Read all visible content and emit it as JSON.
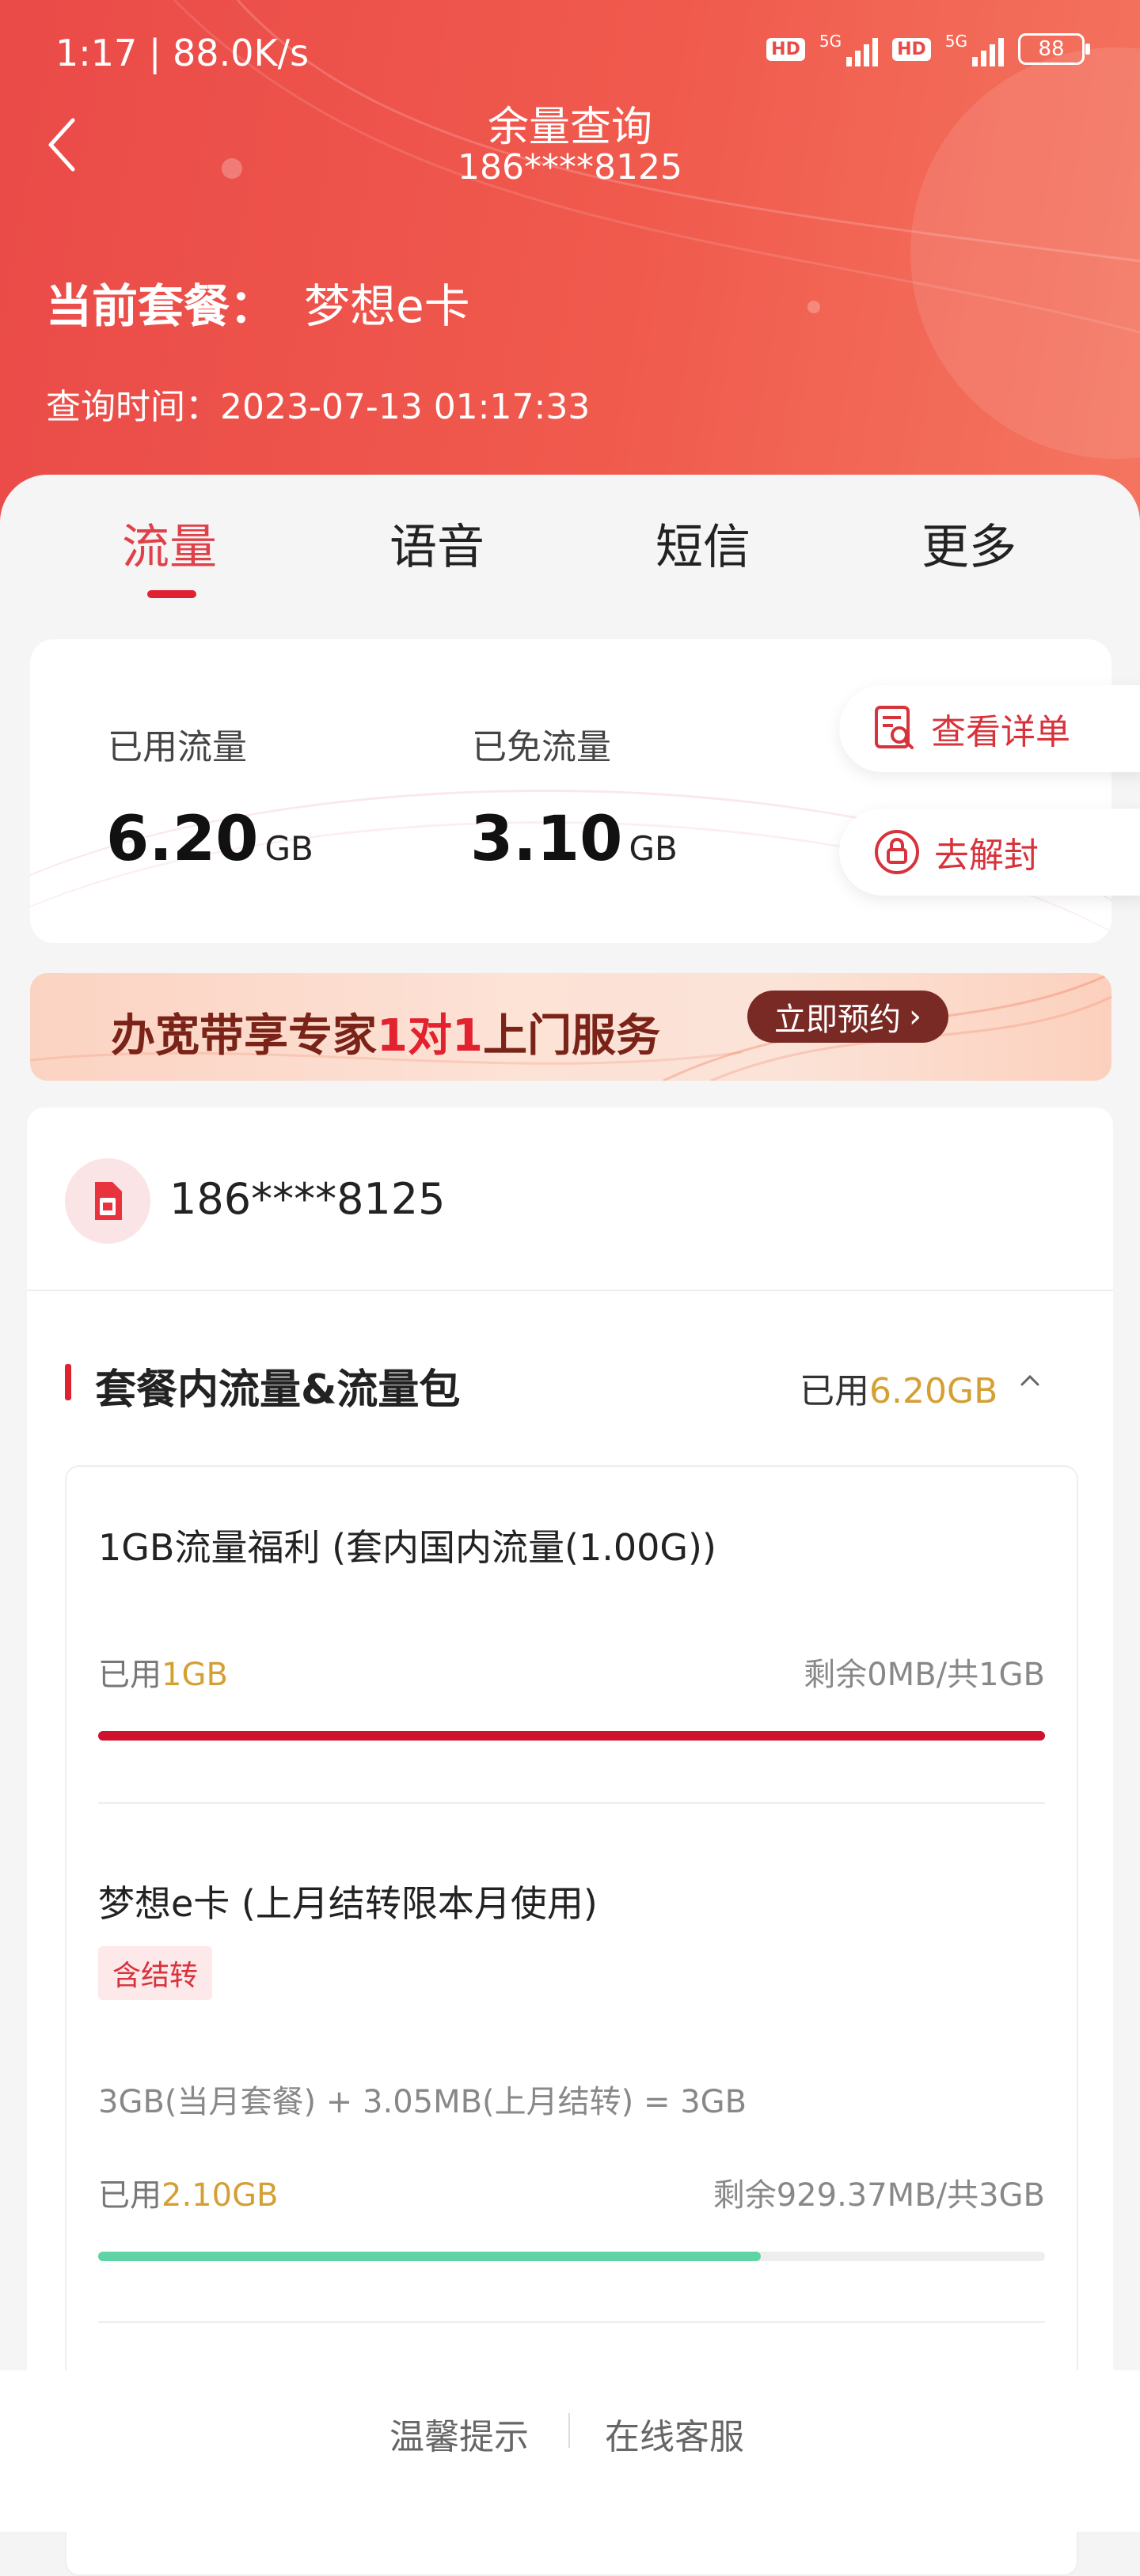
{
  "status_bar": {
    "time": "1:17 | 88.0K/s",
    "hd1": "HD",
    "net1": "5G",
    "hd2": "HD",
    "net2": "5G",
    "battery": "88"
  },
  "header": {
    "title": "余量查询",
    "subtitle": "186****8125",
    "plan_label": "当前套餐：",
    "plan_name": "梦想e卡",
    "query_time": "查询时间：2023-07-13 01:17:33"
  },
  "tabs": [
    {
      "label": "流量",
      "active": true
    },
    {
      "label": "语音",
      "active": false
    },
    {
      "label": "短信",
      "active": false
    },
    {
      "label": "更多",
      "active": false
    }
  ],
  "usage": {
    "used_label": "已用流量",
    "used_value": "6.20",
    "used_unit": "GB",
    "free_label": "已免流量",
    "free_value": "3.10",
    "free_unit": "GB",
    "detail_button": "查看详单",
    "unlock_button": "去解封"
  },
  "banner": {
    "text_pre": "办宽带享专家",
    "text_highlight": "1对1",
    "text_post": "上门服务",
    "button": "立即预约"
  },
  "account": {
    "phone": "186****8125"
  },
  "section": {
    "title": "套餐内流量&流量包",
    "used_prefix": "已用",
    "used_value": "6.20GB"
  },
  "packages": [
    {
      "name": "1GB流量福利 (套内国内流量(1.00G))",
      "used_prefix": "已用",
      "used_value": "1GB",
      "remain": "剩余0MB/共1GB",
      "progress": 1.0,
      "color": "#d0112b"
    },
    {
      "name": "梦想e卡 (上月结转限本月使用)",
      "tag": "含结转",
      "formula": "3GB(当月套餐) + 3.05MB(上月结转) = 3GB",
      "used_prefix": "已用",
      "used_value": "2.10GB",
      "remain": "剩余929.37MB/共3GB",
      "progress": 0.7,
      "color": "#5fd3a4"
    }
  ],
  "footer": {
    "tips": "温馨提示",
    "service": "在线客服"
  },
  "colors": {
    "accent": "#e04048",
    "gold": "#d4a033",
    "header": "#ef5449"
  }
}
